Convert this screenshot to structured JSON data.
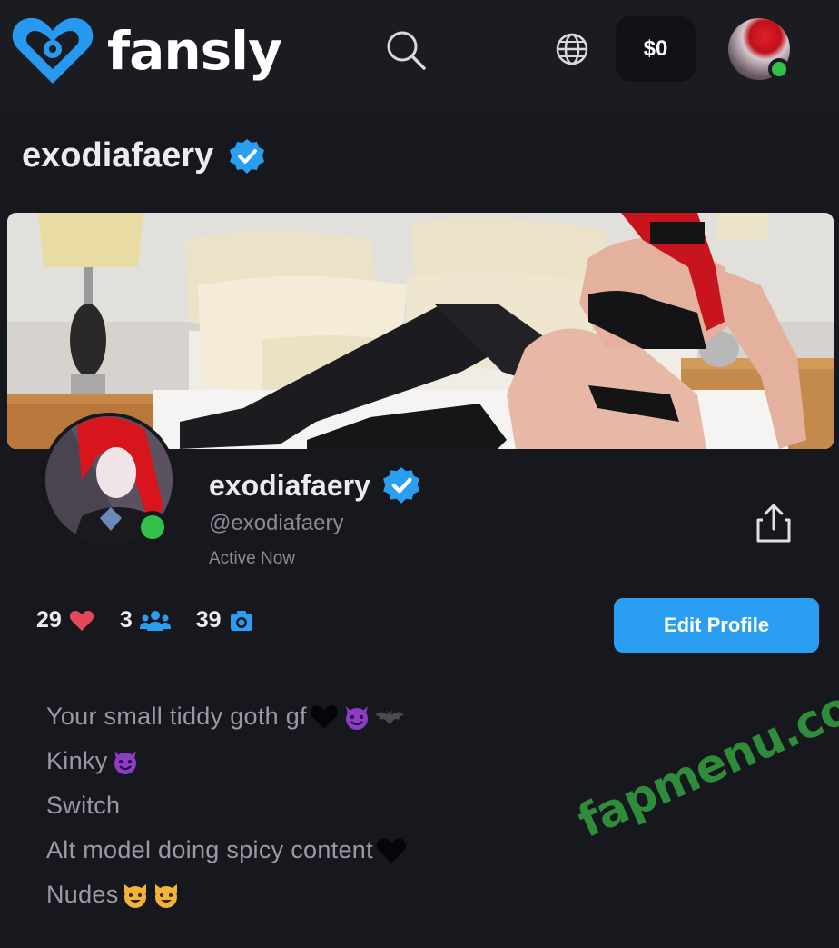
{
  "nav": {
    "logo_text": "fansly",
    "wallet_balance": "$0"
  },
  "page": {
    "title": "exodiafaery"
  },
  "profile": {
    "display_name": "exodiafaery",
    "handle": "@exodiafaery",
    "status": "Active Now",
    "edit_button_label": "Edit Profile"
  },
  "stats": {
    "likes": "29",
    "subscribers": "3",
    "media": "39"
  },
  "bio": {
    "lines": [
      "Your small tiddy goth gf",
      "Kinky",
      "Switch",
      "Alt model doing spicy content ",
      "Nudes"
    ]
  },
  "watermark": "fapmenu.com",
  "colors": {
    "accent": "#2a9ef0",
    "online": "#32c24a",
    "heart": "#e4475a",
    "background": "#17181d",
    "watermark": "#2e8c3a"
  }
}
